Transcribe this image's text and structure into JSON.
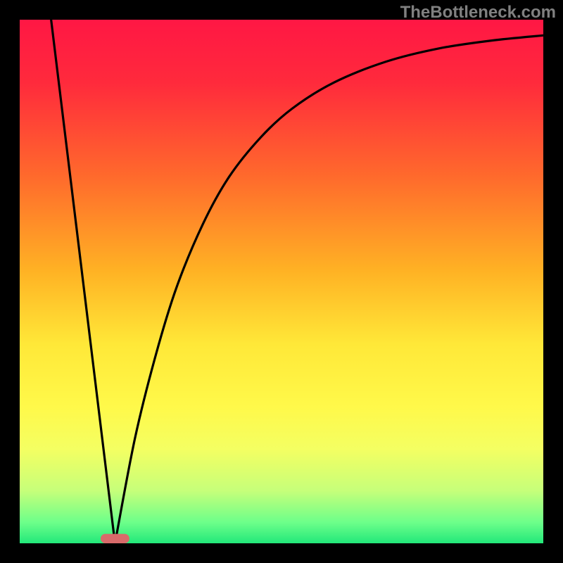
{
  "watermark": "TheBottleneck.com",
  "chart_data": {
    "type": "line",
    "description": "Bottleneck V-curve on a red-to-green vertical gradient background with black frame. Two black curves form a V shape meeting near x≈0.18.",
    "background_gradient_stops": [
      {
        "offset": 0.0,
        "color": "#ff1744"
      },
      {
        "offset": 0.12,
        "color": "#ff2a3c"
      },
      {
        "offset": 0.3,
        "color": "#ff6a2c"
      },
      {
        "offset": 0.48,
        "color": "#ffb224"
      },
      {
        "offset": 0.62,
        "color": "#ffe838"
      },
      {
        "offset": 0.74,
        "color": "#fff94a"
      },
      {
        "offset": 0.82,
        "color": "#f4ff62"
      },
      {
        "offset": 0.9,
        "color": "#c6ff7a"
      },
      {
        "offset": 0.96,
        "color": "#6dff8a"
      },
      {
        "offset": 1.0,
        "color": "#22e87a"
      }
    ],
    "xlim": [
      0,
      1
    ],
    "ylim": [
      0,
      1
    ],
    "frame_thickness_px": 28,
    "marker": {
      "x": 0.182,
      "y": 0.0,
      "color": "#d86a6a",
      "width_frac": 0.055,
      "height_frac": 0.018
    },
    "series": [
      {
        "name": "left-line",
        "type": "linear",
        "x": [
          0.06,
          0.182
        ],
        "y": [
          1.0,
          0.0
        ]
      },
      {
        "name": "right-curve",
        "type": "curve",
        "x": [
          0.182,
          0.22,
          0.26,
          0.3,
          0.35,
          0.4,
          0.46,
          0.52,
          0.6,
          0.7,
          0.8,
          0.9,
          1.0
        ],
        "y": [
          0.0,
          0.2,
          0.36,
          0.49,
          0.61,
          0.7,
          0.775,
          0.83,
          0.88,
          0.92,
          0.945,
          0.96,
          0.97
        ]
      }
    ]
  }
}
